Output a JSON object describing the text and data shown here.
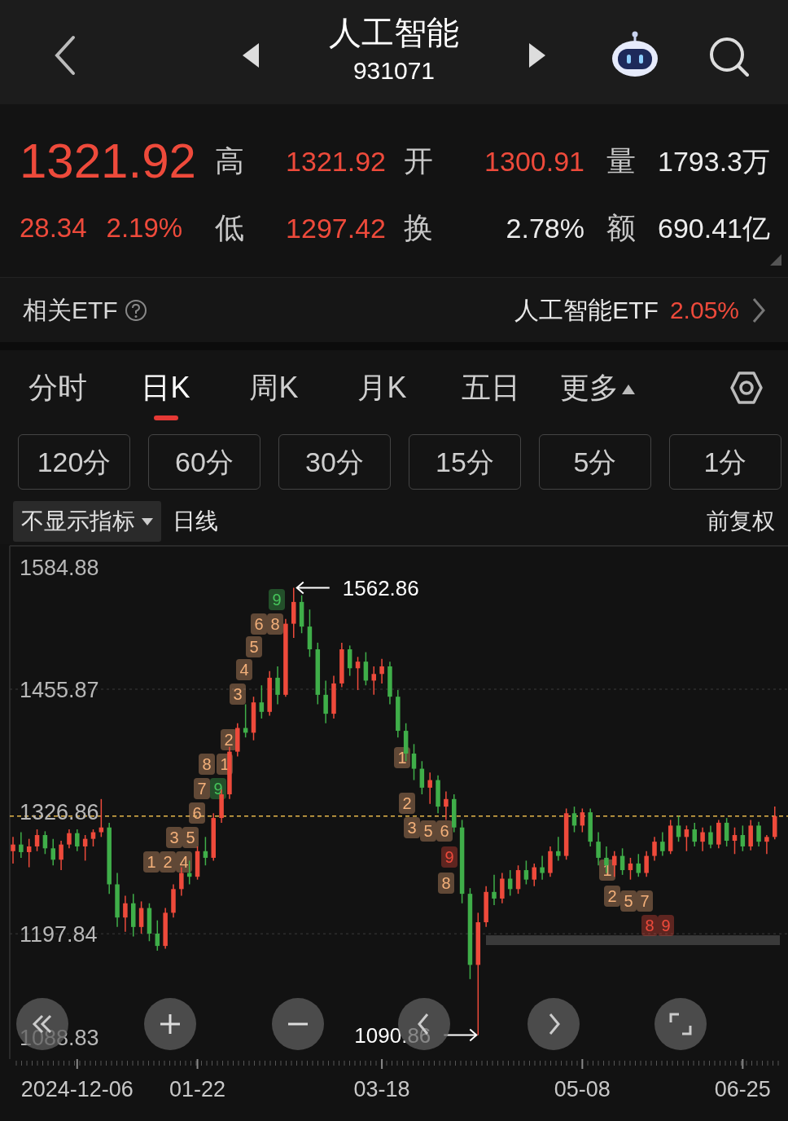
{
  "header": {
    "title": "人工智能",
    "code": "931071"
  },
  "quote": {
    "price": "1321.92",
    "change": "28.34",
    "change_pct": "2.19%",
    "stats": [
      {
        "label": "高",
        "value": "1321.92",
        "color": "#ee4a3b"
      },
      {
        "label": "开",
        "value": "1300.91",
        "color": "#ee4a3b"
      },
      {
        "label": "量",
        "value": "1793.3万",
        "color": "#ececec"
      },
      {
        "label": "低",
        "value": "1297.42",
        "color": "#ee4a3b"
      },
      {
        "label": "换",
        "value": "2.78%",
        "color": "#ececec"
      },
      {
        "label": "额",
        "value": "690.41亿",
        "color": "#ececec"
      }
    ]
  },
  "etf": {
    "label": "相关ETF",
    "name": "人工智能ETF",
    "change": "2.05%"
  },
  "tabs": [
    {
      "label": "分时",
      "selected": false,
      "kind": "tab"
    },
    {
      "label": "日K",
      "selected": true,
      "kind": "tab"
    },
    {
      "label": "周K",
      "selected": false,
      "kind": "tab"
    },
    {
      "label": "月K",
      "selected": false,
      "kind": "tab"
    },
    {
      "label": "五日",
      "selected": false,
      "kind": "tab"
    },
    {
      "label": "更多",
      "selected": false,
      "kind": "menu"
    }
  ],
  "intervals": [
    {
      "label": "120分",
      "selected": false
    },
    {
      "label": "60分",
      "selected": false
    },
    {
      "label": "30分",
      "selected": false
    },
    {
      "label": "15分",
      "selected": false
    },
    {
      "label": "5分",
      "selected": false
    },
    {
      "label": "1分",
      "selected": false
    }
  ],
  "chart_toolbar": {
    "indicator": "不显示指标",
    "period": "日线",
    "adjust": "前复权"
  },
  "chart": {
    "chart_data": {
      "type": "candlestick",
      "categories": [
        null,
        null,
        null,
        null,
        null,
        null,
        null,
        null,
        "2024-12-06",
        null,
        null,
        null,
        null,
        null,
        null,
        null,
        null,
        null,
        null,
        null,
        null,
        null,
        null,
        "01-22",
        null,
        null,
        null,
        null,
        null,
        null,
        null,
        null,
        null,
        null,
        null,
        null,
        null,
        null,
        null,
        null,
        null,
        null,
        null,
        null,
        null,
        null,
        "03-18",
        null,
        null,
        null,
        null,
        null,
        null,
        null,
        null,
        null,
        null,
        null,
        null,
        null,
        null,
        null,
        null,
        null,
        null,
        null,
        null,
        null,
        null,
        null,
        null,
        "05-08",
        null,
        null,
        null,
        null,
        null,
        null,
        null,
        null,
        null,
        null,
        null,
        null,
        null,
        null,
        null,
        null,
        null,
        null,
        null,
        "06-25",
        null,
        null,
        null,
        null
      ],
      "ohlc": [
        [
          1285,
          1300,
          1272,
          1292
        ],
        [
          1292,
          1305,
          1278,
          1284
        ],
        [
          1284,
          1298,
          1268,
          1290
        ],
        [
          1290,
          1308,
          1285,
          1302
        ],
        [
          1302,
          1306,
          1282,
          1288
        ],
        [
          1288,
          1298,
          1270,
          1276
        ],
        [
          1276,
          1296,
          1265,
          1292
        ],
        [
          1292,
          1308,
          1288,
          1304
        ],
        [
          1304,
          1308,
          1285,
          1290
        ],
        [
          1290,
          1302,
          1275,
          1298
        ],
        [
          1298,
          1308,
          1290,
          1305
        ],
        [
          1305,
          1340,
          1300,
          1310
        ],
        [
          1310,
          1315,
          1240,
          1250
        ],
        [
          1250,
          1262,
          1205,
          1215
        ],
        [
          1215,
          1238,
          1200,
          1230
        ],
        [
          1230,
          1240,
          1195,
          1205
        ],
        [
          1205,
          1232,
          1198,
          1225
        ],
        [
          1225,
          1230,
          1190,
          1198
        ],
        [
          1198,
          1212,
          1180,
          1185
        ],
        [
          1185,
          1225,
          1182,
          1220
        ],
        [
          1220,
          1250,
          1215,
          1245
        ],
        [
          1245,
          1268,
          1238,
          1262
        ],
        [
          1262,
          1275,
          1250,
          1258
        ],
        [
          1258,
          1290,
          1255,
          1285
        ],
        [
          1285,
          1300,
          1270,
          1278
        ],
        [
          1278,
          1325,
          1275,
          1320
        ],
        [
          1320,
          1350,
          1315,
          1345
        ],
        [
          1345,
          1395,
          1340,
          1390
        ],
        [
          1390,
          1420,
          1385,
          1415
        ],
        [
          1415,
          1440,
          1405,
          1410
        ],
        [
          1410,
          1448,
          1402,
          1442
        ],
        [
          1442,
          1460,
          1425,
          1432
        ],
        [
          1432,
          1475,
          1428,
          1468
        ],
        [
          1468,
          1480,
          1440,
          1450
        ],
        [
          1450,
          1530,
          1448,
          1525
        ],
        [
          1525,
          1562.86,
          1510,
          1548
        ],
        [
          1548,
          1555,
          1515,
          1522
        ],
        [
          1522,
          1540,
          1490,
          1498
        ],
        [
          1498,
          1505,
          1440,
          1450
        ],
        [
          1450,
          1465,
          1420,
          1430
        ],
        [
          1430,
          1470,
          1425,
          1462
        ],
        [
          1462,
          1505,
          1458,
          1498
        ],
        [
          1498,
          1502,
          1470,
          1478
        ],
        [
          1478,
          1490,
          1455,
          1485
        ],
        [
          1485,
          1495,
          1460,
          1465
        ],
        [
          1465,
          1480,
          1450,
          1472
        ],
        [
          1472,
          1488,
          1462,
          1480
        ],
        [
          1480,
          1485,
          1440,
          1448
        ],
        [
          1448,
          1455,
          1405,
          1412
        ],
        [
          1412,
          1420,
          1380,
          1388
        ],
        [
          1388,
          1398,
          1360,
          1372
        ],
        [
          1372,
          1380,
          1345,
          1352
        ],
        [
          1352,
          1368,
          1335,
          1360
        ],
        [
          1360,
          1365,
          1325,
          1332
        ],
        [
          1332,
          1348,
          1318,
          1340
        ],
        [
          1340,
          1345,
          1305,
          1310
        ],
        [
          1310,
          1318,
          1230,
          1240
        ],
        [
          1240,
          1246,
          1150,
          1165
        ],
        [
          1165,
          1220,
          1090.86,
          1210
        ],
        [
          1210,
          1248,
          1205,
          1242
        ],
        [
          1242,
          1260,
          1228,
          1235
        ],
        [
          1235,
          1262,
          1230,
          1256
        ],
        [
          1256,
          1265,
          1238,
          1245
        ],
        [
          1245,
          1270,
          1240,
          1265
        ],
        [
          1265,
          1275,
          1250,
          1255
        ],
        [
          1255,
          1272,
          1248,
          1268
        ],
        [
          1268,
          1280,
          1255,
          1262
        ],
        [
          1262,
          1290,
          1258,
          1285
        ],
        [
          1285,
          1300,
          1275,
          1280
        ],
        [
          1280,
          1330,
          1276,
          1325
        ],
        [
          1325,
          1332,
          1305,
          1312
        ],
        [
          1312,
          1330,
          1305,
          1326
        ],
        [
          1326,
          1330,
          1290,
          1295
        ],
        [
          1295,
          1305,
          1270,
          1278
        ],
        [
          1278,
          1290,
          1262,
          1270
        ],
        [
          1270,
          1285,
          1258,
          1280
        ],
        [
          1280,
          1288,
          1260,
          1265
        ],
        [
          1265,
          1278,
          1255,
          1272
        ],
        [
          1272,
          1282,
          1258,
          1262
        ],
        [
          1262,
          1285,
          1258,
          1280
        ],
        [
          1280,
          1300,
          1275,
          1295
        ],
        [
          1295,
          1305,
          1280,
          1285
        ],
        [
          1285,
          1318,
          1282,
          1312
        ],
        [
          1312,
          1322,
          1295,
          1300
        ],
        [
          1300,
          1312,
          1285,
          1308
        ],
        [
          1308,
          1315,
          1290,
          1295
        ],
        [
          1295,
          1310,
          1285,
          1305
        ],
        [
          1305,
          1312,
          1288,
          1292
        ],
        [
          1292,
          1318,
          1288,
          1315
        ],
        [
          1315,
          1320,
          1290,
          1296
        ],
        [
          1296,
          1310,
          1282,
          1302
        ],
        [
          1302,
          1312,
          1285,
          1290
        ],
        [
          1290,
          1318,
          1286,
          1312
        ],
        [
          1312,
          1316,
          1290,
          1295
        ],
        [
          1295,
          1302,
          1282,
          1300
        ],
        [
          1300,
          1332,
          1297.42,
          1321.92
        ]
      ],
      "ylim": [
        1065.6,
        1607.2
      ],
      "yticks": [
        {
          "value": 1584.88,
          "label": "1584.88"
        },
        {
          "value": 1455.87,
          "label": "1455.87"
        },
        {
          "value": 1326.86,
          "label": "1326.86"
        },
        {
          "value": 1197.84,
          "label": "1197.84"
        },
        {
          "value": 1088.83,
          "label": "1088.83"
        }
      ],
      "ref_lines": [
        {
          "value": 1321.92,
          "axis": "y"
        }
      ],
      "bands": [
        {
          "axis": "y",
          "from": 1185.9,
          "to": 1196.2
        }
      ],
      "annotations": [
        "1562.86",
        "1090.86"
      ]
    },
    "markers": [
      {
        "text": "1",
        "color": "#f3b07a"
      },
      {
        "text": "2",
        "color": "#f3b07a"
      },
      {
        "text": "3",
        "color": "#f3b07a"
      },
      {
        "text": "4",
        "color": "#f3b07a"
      },
      {
        "text": "5",
        "color": "#f3b07a"
      },
      {
        "text": "6",
        "color": "#f3b07a"
      },
      {
        "text": "7",
        "color": "#f3b07a"
      },
      {
        "text": "8",
        "color": "#f3b07a"
      },
      {
        "text": "9",
        "color": "#46c35a"
      },
      {
        "text": "1",
        "color": "#f3b07a"
      },
      {
        "text": "2",
        "color": "#f3b07a"
      },
      {
        "text": "3",
        "color": "#f3b07a"
      },
      {
        "text": "4",
        "color": "#f3b07a"
      },
      {
        "text": "5",
        "color": "#f3b07a"
      },
      {
        "text": "6",
        "color": "#f3b07a"
      },
      {
        "text": "8",
        "color": "#f3b07a"
      },
      {
        "text": "9",
        "color": "#46c35a"
      },
      {
        "text": "1",
        "color": "#f3b07a"
      },
      {
        "text": "2",
        "color": "#f3b07a"
      },
      {
        "text": "3",
        "color": "#f3b07a"
      },
      {
        "text": "5",
        "color": "#f3b07a"
      },
      {
        "text": "6",
        "color": "#f3b07a"
      },
      {
        "text": "9",
        "color": "#ee4a3b"
      },
      {
        "text": "8",
        "color": "#f3b07a"
      },
      {
        "text": "1",
        "color": "#f3b07a"
      },
      {
        "text": "2",
        "color": "#f3b07a"
      },
      {
        "text": "5",
        "color": "#f3b07a"
      },
      {
        "text": "7",
        "color": "#f3b07a"
      },
      {
        "text": "8",
        "color": "#ee4a3b"
      },
      {
        "text": "9",
        "color": "#ee4a3b"
      }
    ]
  }
}
